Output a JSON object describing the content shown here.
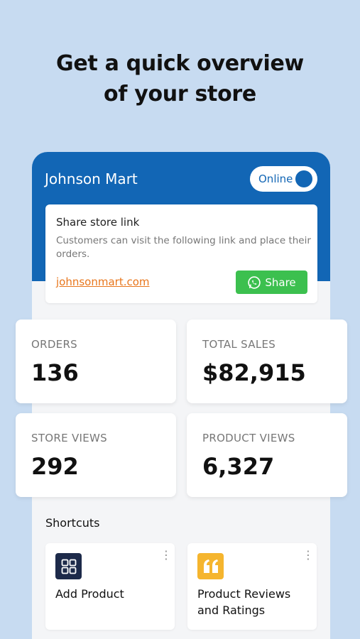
{
  "headline": {
    "line1": "Get a quick overview",
    "line2": "of your store"
  },
  "store": {
    "name": "Johnson Mart",
    "status_label": "Online",
    "status_on": true
  },
  "share": {
    "title": "Share store link",
    "description": "Customers can visit the following link and place their orders.",
    "link": "johnsonmart.com",
    "button_label": "Share",
    "button_icon": "whatsapp-icon"
  },
  "stats": [
    {
      "label": "ORDERS",
      "value": "136"
    },
    {
      "label": "TOTAL SALES",
      "value": "$82,915"
    },
    {
      "label": "STORE VIEWS",
      "value": "292"
    },
    {
      "label": "PRODUCT VIEWS",
      "value": "6,327"
    }
  ],
  "shortcuts": {
    "title": "Shortcuts",
    "items": [
      {
        "label": "Add Product",
        "icon": "grid-icon",
        "icon_color": "#1d2a4a"
      },
      {
        "label": "Product Reviews and Ratings",
        "icon": "quote-icon",
        "icon_color": "#f5b52e"
      }
    ]
  },
  "colors": {
    "background": "#c7dbf1",
    "primary": "#1266b5",
    "link": "#e8761c",
    "share_button": "#3cc04f"
  }
}
